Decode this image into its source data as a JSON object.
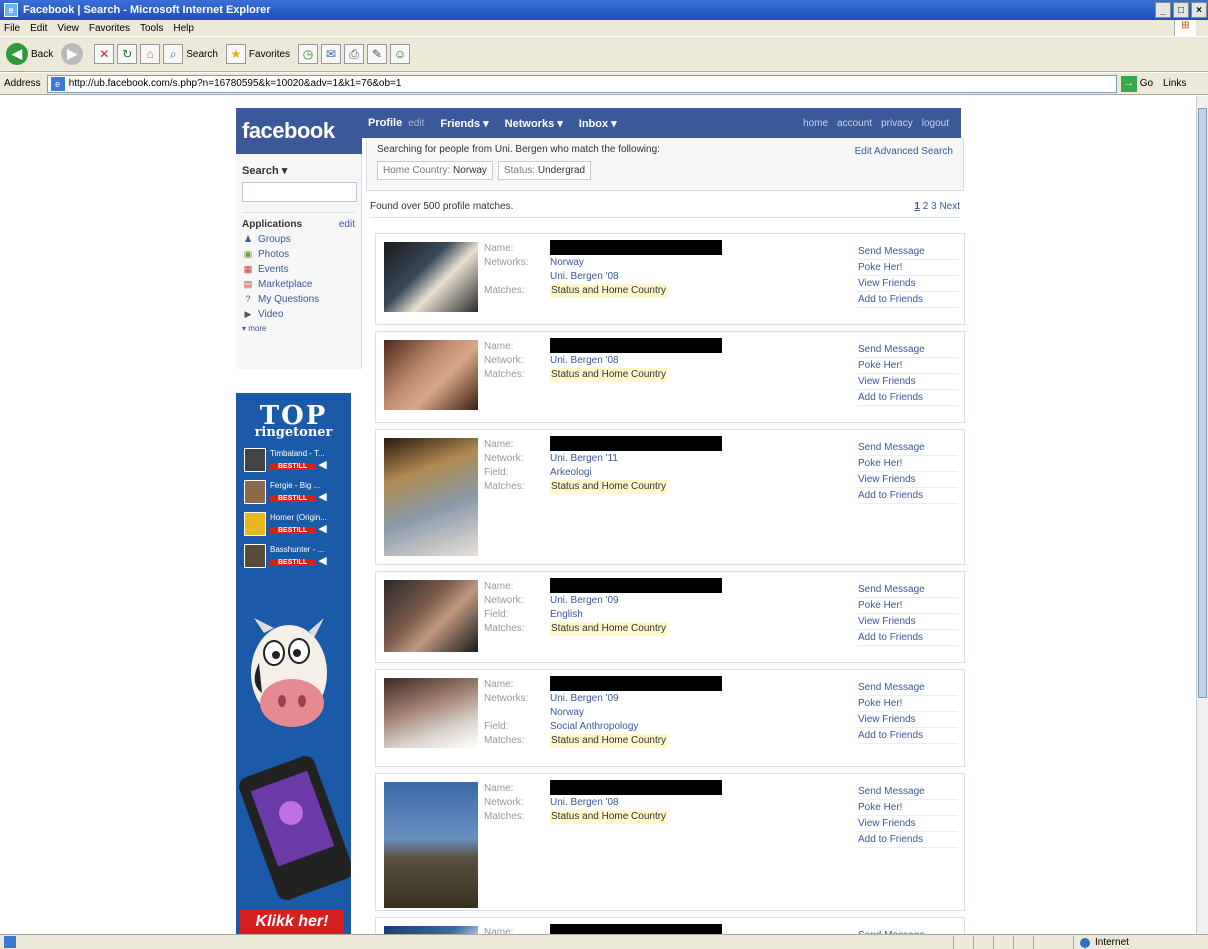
{
  "window": {
    "title": "Facebook | Search - Microsoft Internet Explorer",
    "menu": [
      "File",
      "Edit",
      "View",
      "Favorites",
      "Tools",
      "Help"
    ],
    "toolbar": {
      "back": "Back",
      "search": "Search",
      "favorites": "Favorites"
    },
    "address_label": "Address",
    "url": "http://ub.facebook.com/s.php?n=16780595&k=10020&adv=1&k1=76&ob=1",
    "go": "Go",
    "links": "Links",
    "status_zone": "Internet"
  },
  "fb": {
    "logo": "facebook",
    "nav": {
      "profile": "Profile",
      "profile_edit": "edit",
      "friends": "Friends ▾",
      "networks": "Networks ▾",
      "inbox": "Inbox ▾",
      "home": "home",
      "account": "account",
      "privacy": "privacy",
      "logout": "logout"
    },
    "sidebar": {
      "search_label": "Search ▾",
      "apps_title": "Applications",
      "apps_edit": "edit",
      "apps": [
        {
          "label": "Groups",
          "icon": "groups-icon"
        },
        {
          "label": "Photos",
          "icon": "photos-icon"
        },
        {
          "label": "Events",
          "icon": "events-icon"
        },
        {
          "label": "Marketplace",
          "icon": "marketplace-icon"
        },
        {
          "label": "My Questions",
          "icon": "questions-icon"
        },
        {
          "label": "Video",
          "icon": "video-icon"
        }
      ],
      "more": "▾ more"
    },
    "ad": {
      "top": "TOP",
      "sub": "ringetoner",
      "items": [
        {
          "name": "Timbaland - T...",
          "btn": "BESTILL"
        },
        {
          "name": "Fergie - Big ...",
          "btn": "BESTILL"
        },
        {
          "name": "Homer (Origin...",
          "btn": "BESTILL"
        },
        {
          "name": "Basshunter - ...",
          "btn": "BESTILL"
        }
      ],
      "cta": "Klikk her!"
    },
    "criteria": {
      "text": "Searching for people from Uni. Bergen who match the following:",
      "edit_link": "Edit Advanced Search",
      "chips": [
        {
          "k": "Home Country:",
          "v": "Norway"
        },
        {
          "k": "Status:",
          "v": "Undergrad"
        }
      ]
    },
    "found": "Found over 500 profile matches.",
    "pager": {
      "p1": "1",
      "p2": "2",
      "p3": "3",
      "next": "Next"
    },
    "actions": {
      "send": "Send Message",
      "poke": "Poke Her!",
      "friends": "View Friends",
      "add": "Add to Friends"
    },
    "results": [
      {
        "rows": [
          {
            "label": "Name:",
            "value": "",
            "type": "redact"
          },
          {
            "label": "Networks:",
            "value": "Norway",
            "type": "link"
          },
          {
            "label": "",
            "value": "Uni. Bergen '08",
            "type": "link"
          },
          {
            "label": "Matches:",
            "value": "Status and Home Country",
            "type": "hl"
          }
        ]
      },
      {
        "rows": [
          {
            "label": "Name:",
            "value": "",
            "type": "redact"
          },
          {
            "label": "Network:",
            "value": "Uni. Bergen '08",
            "type": "link"
          },
          {
            "label": "Matches:",
            "value": "Status and Home Country",
            "type": "hl"
          }
        ]
      },
      {
        "rows": [
          {
            "label": "Name:",
            "value": "",
            "type": "redact"
          },
          {
            "label": "Network:",
            "value": "Uni. Bergen '11",
            "type": "link"
          },
          {
            "label": "Field:",
            "value": "Arkeologi",
            "type": "link"
          },
          {
            "label": "Matches:",
            "value": "Status and Home Country",
            "type": "hl"
          }
        ]
      },
      {
        "rows": [
          {
            "label": "Name:",
            "value": "",
            "type": "redact"
          },
          {
            "label": "Network:",
            "value": "Uni. Bergen '09",
            "type": "link"
          },
          {
            "label": "Field:",
            "value": "English",
            "type": "link"
          },
          {
            "label": "Matches:",
            "value": "Status and Home Country",
            "type": "hl"
          }
        ]
      },
      {
        "rows": [
          {
            "label": "Name:",
            "value": "",
            "type": "redact"
          },
          {
            "label": "Networks:",
            "value": "Uni. Bergen '09",
            "type": "link"
          },
          {
            "label": "",
            "value": "Norway",
            "type": "link"
          },
          {
            "label": "Field:",
            "value": "Social Anthropology",
            "type": "link"
          },
          {
            "label": "Matches:",
            "value": "Status and Home Country",
            "type": "hl"
          }
        ]
      },
      {
        "rows": [
          {
            "label": "Name:",
            "value": "",
            "type": "redact"
          },
          {
            "label": "Network:",
            "value": "Uni. Bergen '08",
            "type": "link"
          },
          {
            "label": "Matches:",
            "value": "Status and Home Country",
            "type": "hl"
          }
        ]
      },
      {
        "rows": [
          {
            "label": "Name:",
            "value": "",
            "type": "redact"
          }
        ]
      }
    ]
  }
}
